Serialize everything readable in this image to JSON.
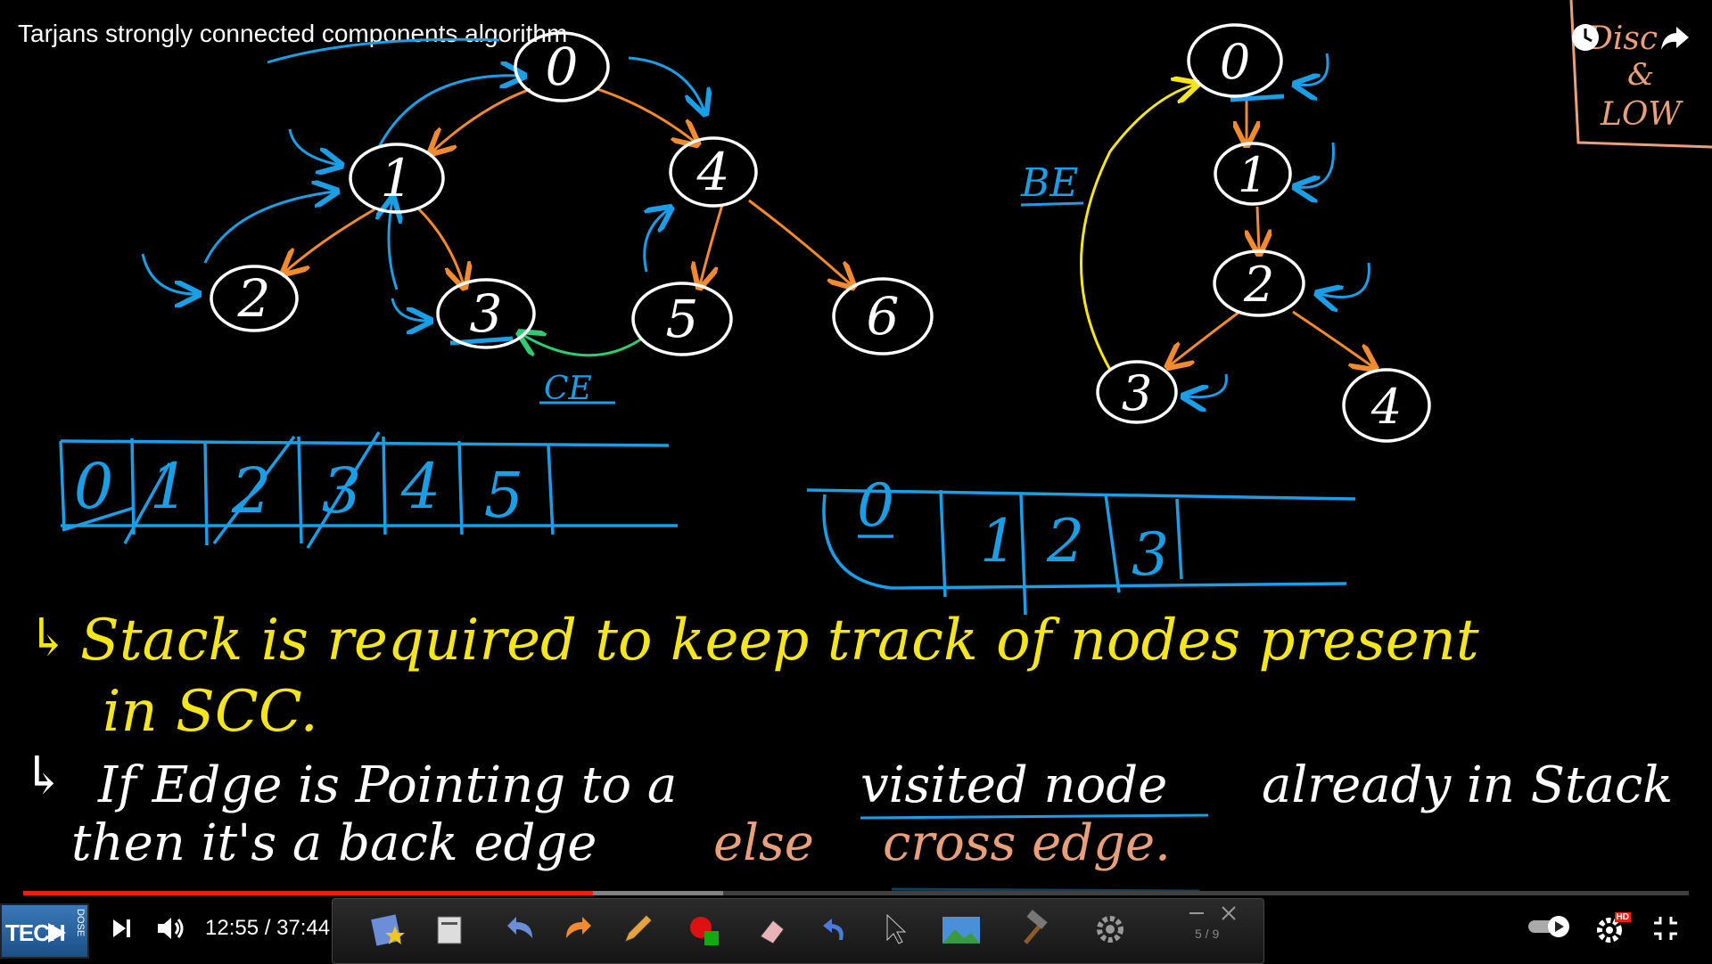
{
  "video": {
    "title": "Tarjans strongly connected components algorithm",
    "current_time": "12:55",
    "duration": "37:44",
    "time_display": "12:55 / 37:44",
    "progress_fraction": 0.342,
    "buffered_fraction": 0.42
  },
  "left_graph": {
    "nodes": [
      "0",
      "1",
      "2",
      "3",
      "4",
      "5",
      "6"
    ],
    "labels": {
      "cross_edge": "CE"
    }
  },
  "right_graph": {
    "nodes": [
      "0",
      "1",
      "2",
      "3",
      "4"
    ],
    "labels": {
      "back_edge": "BE"
    }
  },
  "corner_note": {
    "line1": "Disc",
    "line2": "&",
    "line3": "LOW"
  },
  "left_stack": [
    "0",
    "1",
    "2",
    "3",
    "4",
    "5"
  ],
  "right_stack": [
    "0",
    "1",
    "2",
    "3"
  ],
  "notes": {
    "arrow": "↳",
    "line1a": "Stack is required to keep track of nodes present",
    "line1b": "in SCC.",
    "line2a_pre": "If Edge is Pointing to a",
    "line2a_visited": "visited node",
    "line2a_post": "already in Stack",
    "line2b_pre": "then it's a back edge",
    "line2b_else": "else",
    "line2b_cross": "cross edge."
  },
  "player": {
    "logo_text": "TECH",
    "logo_side": "DOSE",
    "page_indicator": "5 / 9",
    "hd_badge": "HD"
  },
  "colors": {
    "node": "#ffffff",
    "tree_edge": "#f28a2e",
    "blue_ink": "#1a9ee6",
    "yellow_ink": "#f5e61a",
    "green_ink": "#2ecc71",
    "peach_ink": "#e8a07a",
    "progress": "#e62117"
  }
}
